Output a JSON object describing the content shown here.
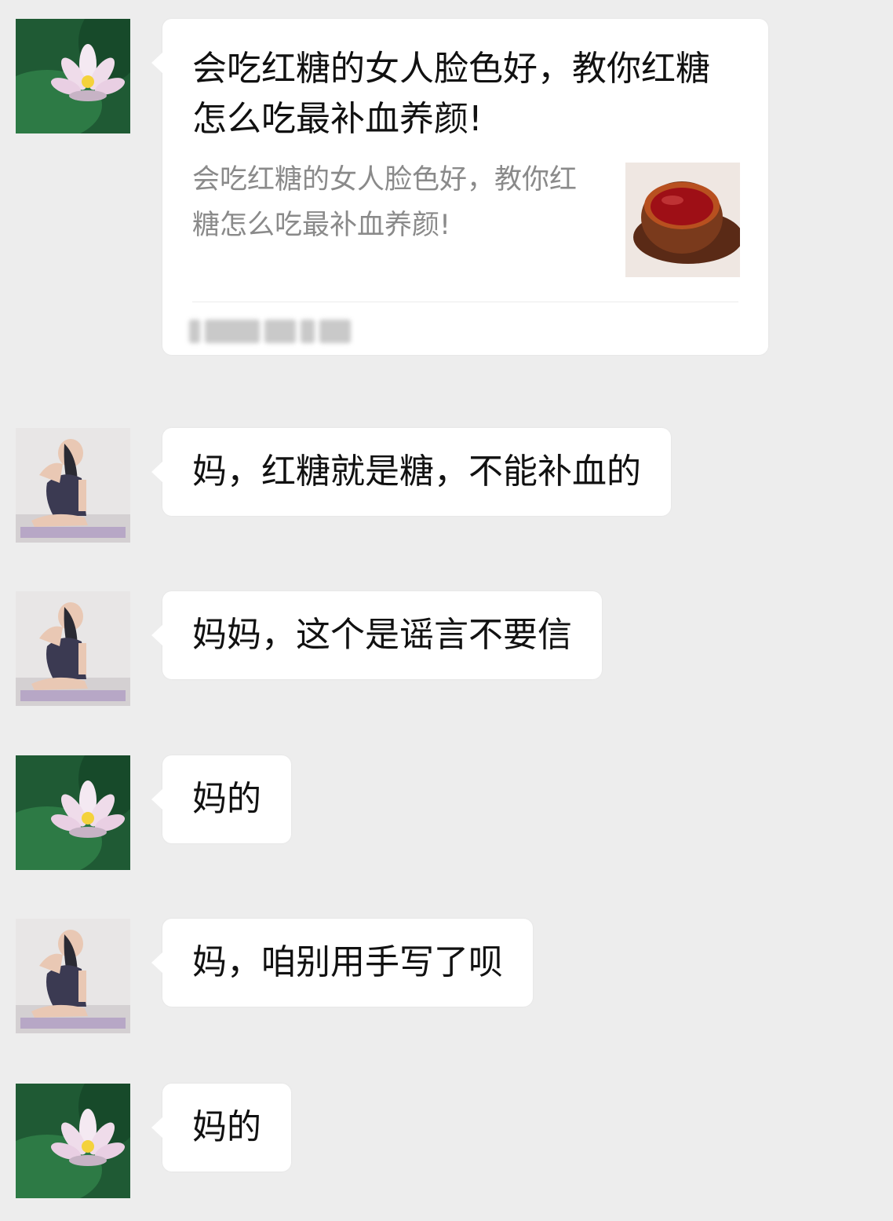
{
  "messages": [
    {
      "sender": "mom",
      "type": "link_card",
      "title": "会吃红糖的女人脸色好，教你红糖怎么吃最补血养颜!",
      "description": "会吃红糖的女人脸色好，教你红糖怎么吃最补血养颜!",
      "thumbnail_icon": "red-tea-cup-icon",
      "source_blurred": true
    },
    {
      "sender": "child",
      "type": "text",
      "text": "妈，红糖就是糖，不能补血的"
    },
    {
      "sender": "child",
      "type": "text",
      "text": "妈妈，这个是谣言不要信"
    },
    {
      "sender": "mom",
      "type": "text",
      "text": "妈的"
    },
    {
      "sender": "child",
      "type": "text",
      "text": "妈，咱别用手写了呗"
    },
    {
      "sender": "mom",
      "type": "text",
      "text": "妈的"
    }
  ],
  "avatars": {
    "mom": "lotus-flower-avatar",
    "child": "yoga-pose-avatar"
  },
  "colors": {
    "background": "#ededed",
    "bubble": "#ffffff",
    "text": "#111111",
    "card_desc": "#8a8a8a"
  }
}
